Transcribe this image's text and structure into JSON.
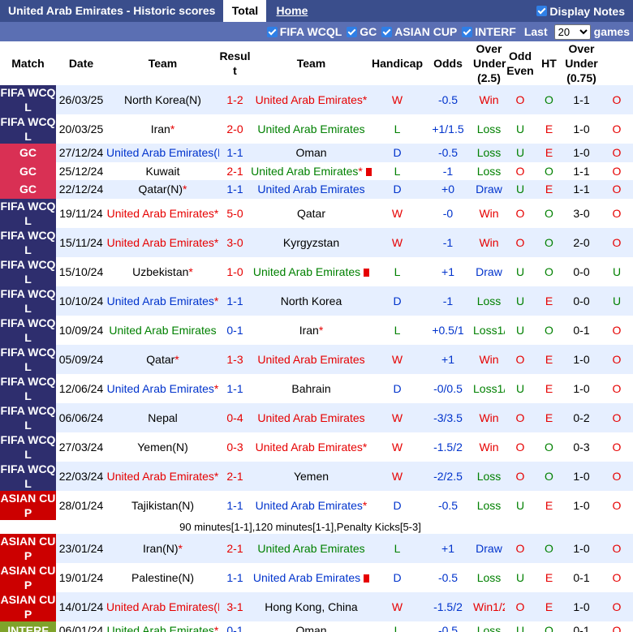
{
  "header": {
    "title": "United Arab Emirates - Historic scores",
    "tab_total": "Total",
    "tab_home": "Home",
    "display_notes": "Display Notes"
  },
  "filters": {
    "items": [
      "FIFA WCQL",
      "GC",
      "ASIAN CUP",
      "INTERF"
    ],
    "last_label": "Last",
    "games_value": "20",
    "games_label": "games"
  },
  "columns": {
    "match": "Match",
    "date": "Date",
    "team": "Team",
    "result": "Resul t",
    "team2": "Team",
    "handicap": "Handicap",
    "odds": "Odds",
    "over_under": "Over Under (2.5)",
    "odd_even": "Odd Even",
    "ht": "HT",
    "over_under2": "Over Under (0.75)"
  },
  "colors": {
    "header_bar": "#3a4e8c",
    "filter_bar": "#5b6fb3",
    "fifa": "#2e2e6e",
    "gc": "#d93054",
    "asian": "#cc0000",
    "interf": "#7fa32a",
    "row_alt": "#e6efff"
  },
  "rows": [
    {
      "type": "match",
      "comp": "FIFA WCQ L",
      "compClass": "fifa",
      "date": "26/03/25",
      "home": "North Korea(N)",
      "homeColor": "",
      "homeStar": false,
      "homeCard": false,
      "score": "1-2",
      "scoreColor": "red",
      "away": "United Arab Emirates",
      "awayColor": "red",
      "awayStar": true,
      "awayCard": false,
      "res": "W",
      "resColor": "red",
      "hcp": "-0.5",
      "odds": "Win",
      "oddsColor": "red",
      "ou": "O",
      "ouColor": "red",
      "oe": "O",
      "oeColor": "green",
      "ht": "1-1",
      "ou2": "O",
      "ou2Color": "red"
    },
    {
      "type": "match",
      "comp": "FIFA WCQ L",
      "compClass": "fifa",
      "date": "20/03/25",
      "home": "Iran",
      "homeColor": "",
      "homeStar": true,
      "homeCard": false,
      "score": "2-0",
      "scoreColor": "red",
      "away": "United Arab Emirates",
      "awayColor": "green",
      "awayStar": false,
      "awayCard": false,
      "res": "L",
      "resColor": "green",
      "hcp": "+1/1.5",
      "odds": "Loss",
      "oddsColor": "green",
      "ou": "U",
      "ouColor": "green",
      "oe": "E",
      "oeColor": "red",
      "ht": "1-0",
      "ou2": "O",
      "ou2Color": "red"
    },
    {
      "type": "match",
      "comp": "GC",
      "compClass": "gc",
      "date": "27/12/24",
      "home": "United Arab Emirates(N)",
      "homeColor": "blue",
      "homeStar": true,
      "homeCard": false,
      "score": "1-1",
      "scoreColor": "blue",
      "away": "Oman",
      "awayColor": "",
      "awayStar": false,
      "awayCard": false,
      "res": "D",
      "resColor": "blue",
      "hcp": "-0.5",
      "odds": "Loss",
      "oddsColor": "green",
      "ou": "U",
      "ouColor": "green",
      "oe": "E",
      "oeColor": "red",
      "ht": "1-0",
      "ou2": "O",
      "ou2Color": "red"
    },
    {
      "type": "match",
      "comp": "GC",
      "compClass": "gc",
      "date": "25/12/24",
      "home": "Kuwait",
      "homeColor": "",
      "homeStar": false,
      "homeCard": false,
      "score": "2-1",
      "scoreColor": "red",
      "away": "United Arab Emirates",
      "awayColor": "green",
      "awayStar": true,
      "awayCard": true,
      "res": "L",
      "resColor": "green",
      "hcp": "-1",
      "odds": "Loss",
      "oddsColor": "green",
      "ou": "O",
      "ouColor": "red",
      "oe": "O",
      "oeColor": "green",
      "ht": "1-1",
      "ou2": "O",
      "ou2Color": "red"
    },
    {
      "type": "match",
      "comp": "GC",
      "compClass": "gc",
      "date": "22/12/24",
      "home": "Qatar(N)",
      "homeColor": "",
      "homeStar": true,
      "homeCard": false,
      "score": "1-1",
      "scoreColor": "blue",
      "away": "United Arab Emirates",
      "awayColor": "blue",
      "awayStar": false,
      "awayCard": false,
      "res": "D",
      "resColor": "blue",
      "hcp": "+0",
      "odds": "Draw",
      "oddsColor": "blue",
      "ou": "U",
      "ouColor": "green",
      "oe": "E",
      "oeColor": "red",
      "ht": "1-1",
      "ou2": "O",
      "ou2Color": "red"
    },
    {
      "type": "match",
      "comp": "FIFA WCQ L",
      "compClass": "fifa",
      "date": "19/11/24",
      "home": "United Arab Emirates",
      "homeColor": "red",
      "homeStar": true,
      "homeCard": false,
      "score": "5-0",
      "scoreColor": "red",
      "away": "Qatar",
      "awayColor": "",
      "awayStar": false,
      "awayCard": false,
      "res": "W",
      "resColor": "red",
      "hcp": "-0",
      "odds": "Win",
      "oddsColor": "red",
      "ou": "O",
      "ouColor": "red",
      "oe": "O",
      "oeColor": "green",
      "ht": "3-0",
      "ou2": "O",
      "ou2Color": "red"
    },
    {
      "type": "match",
      "comp": "FIFA WCQ L",
      "compClass": "fifa",
      "date": "15/11/24",
      "home": "United Arab Emirates",
      "homeColor": "red",
      "homeStar": true,
      "homeCard": false,
      "score": "3-0",
      "scoreColor": "red",
      "away": "Kyrgyzstan",
      "awayColor": "",
      "awayStar": false,
      "awayCard": false,
      "res": "W",
      "resColor": "red",
      "hcp": "-1",
      "odds": "Win",
      "oddsColor": "red",
      "ou": "O",
      "ouColor": "red",
      "oe": "O",
      "oeColor": "green",
      "ht": "2-0",
      "ou2": "O",
      "ou2Color": "red"
    },
    {
      "type": "match",
      "comp": "FIFA WCQ L",
      "compClass": "fifa",
      "date": "15/10/24",
      "home": "Uzbekistan",
      "homeColor": "",
      "homeStar": true,
      "homeCard": false,
      "score": "1-0",
      "scoreColor": "red",
      "away": "United Arab Emirates",
      "awayColor": "green",
      "awayStar": false,
      "awayCard": true,
      "res": "L",
      "resColor": "green",
      "hcp": "+1",
      "odds": "Draw",
      "oddsColor": "blue",
      "ou": "U",
      "ouColor": "green",
      "oe": "O",
      "oeColor": "green",
      "ht": "0-0",
      "ou2": "U",
      "ou2Color": "green"
    },
    {
      "type": "match",
      "comp": "FIFA WCQ L",
      "compClass": "fifa",
      "date": "10/10/24",
      "home": "United Arab Emirates",
      "homeColor": "blue",
      "homeStar": true,
      "homeCard": false,
      "score": "1-1",
      "scoreColor": "blue",
      "away": "North Korea",
      "awayColor": "",
      "awayStar": false,
      "awayCard": false,
      "res": "D",
      "resColor": "blue",
      "hcp": "-1",
      "odds": "Loss",
      "oddsColor": "green",
      "ou": "U",
      "ouColor": "green",
      "oe": "E",
      "oeColor": "red",
      "ht": "0-0",
      "ou2": "U",
      "ou2Color": "green"
    },
    {
      "type": "match",
      "comp": "FIFA WCQ L",
      "compClass": "fifa",
      "date": "10/09/24",
      "home": "United Arab Emirates",
      "homeColor": "green",
      "homeStar": false,
      "homeCard": false,
      "score": "0-1",
      "scoreColor": "blue",
      "away": "Iran",
      "awayColor": "",
      "awayStar": true,
      "awayCard": false,
      "res": "L",
      "resColor": "green",
      "hcp": "+0.5/1",
      "odds": "Loss1/2",
      "oddsColor": "green",
      "ou": "U",
      "ouColor": "green",
      "oe": "O",
      "oeColor": "green",
      "ht": "0-1",
      "ou2": "O",
      "ou2Color": "red"
    },
    {
      "type": "match",
      "comp": "FIFA WCQ L",
      "compClass": "fifa",
      "date": "05/09/24",
      "home": "Qatar",
      "homeColor": "",
      "homeStar": true,
      "homeCard": false,
      "score": "1-3",
      "scoreColor": "red",
      "away": "United Arab Emirates",
      "awayColor": "red",
      "awayStar": false,
      "awayCard": false,
      "res": "W",
      "resColor": "red",
      "hcp": "+1",
      "odds": "Win",
      "oddsColor": "red",
      "ou": "O",
      "ouColor": "red",
      "oe": "E",
      "oeColor": "red",
      "ht": "1-0",
      "ou2": "O",
      "ou2Color": "red"
    },
    {
      "type": "match",
      "comp": "FIFA WCQ L",
      "compClass": "fifa",
      "date": "12/06/24",
      "home": "United Arab Emirates",
      "homeColor": "blue",
      "homeStar": true,
      "homeCard": false,
      "score": "1-1",
      "scoreColor": "blue",
      "away": "Bahrain",
      "awayColor": "",
      "awayStar": false,
      "awayCard": false,
      "res": "D",
      "resColor": "blue",
      "hcp": "-0/0.5",
      "odds": "Loss1/2",
      "oddsColor": "green",
      "ou": "U",
      "ouColor": "green",
      "oe": "E",
      "oeColor": "red",
      "ht": "1-0",
      "ou2": "O",
      "ou2Color": "red"
    },
    {
      "type": "match",
      "comp": "FIFA WCQ L",
      "compClass": "fifa",
      "date": "06/06/24",
      "home": "Nepal",
      "homeColor": "",
      "homeStar": false,
      "homeCard": false,
      "score": "0-4",
      "scoreColor": "red",
      "away": "United Arab Emirates",
      "awayColor": "red",
      "awayStar": false,
      "awayCard": false,
      "res": "W",
      "resColor": "red",
      "hcp": "-3/3.5",
      "odds": "Win",
      "oddsColor": "red",
      "ou": "O",
      "ouColor": "red",
      "oe": "E",
      "oeColor": "red",
      "ht": "0-2",
      "ou2": "O",
      "ou2Color": "red"
    },
    {
      "type": "match",
      "comp": "FIFA WCQ L",
      "compClass": "fifa",
      "date": "27/03/24",
      "home": "Yemen(N)",
      "homeColor": "",
      "homeStar": false,
      "homeCard": false,
      "score": "0-3",
      "scoreColor": "red",
      "away": "United Arab Emirates",
      "awayColor": "red",
      "awayStar": true,
      "awayCard": false,
      "res": "W",
      "resColor": "red",
      "hcp": "-1.5/2",
      "odds": "Win",
      "oddsColor": "red",
      "ou": "O",
      "ouColor": "red",
      "oe": "O",
      "oeColor": "green",
      "ht": "0-3",
      "ou2": "O",
      "ou2Color": "red"
    },
    {
      "type": "match",
      "comp": "FIFA WCQ L",
      "compClass": "fifa",
      "date": "22/03/24",
      "home": "United Arab Emirates",
      "homeColor": "red",
      "homeStar": true,
      "homeCard": false,
      "score": "2-1",
      "scoreColor": "red",
      "away": "Yemen",
      "awayColor": "",
      "awayStar": false,
      "awayCard": false,
      "res": "W",
      "resColor": "red",
      "hcp": "-2/2.5",
      "odds": "Loss",
      "oddsColor": "green",
      "ou": "O",
      "ouColor": "red",
      "oe": "O",
      "oeColor": "green",
      "ht": "1-0",
      "ou2": "O",
      "ou2Color": "red"
    },
    {
      "type": "match",
      "comp": "ASIAN CU P",
      "compClass": "asian",
      "date": "28/01/24",
      "home": "Tajikistan(N)",
      "homeColor": "",
      "homeStar": false,
      "homeCard": false,
      "score": "1-1",
      "scoreColor": "blue",
      "away": "United Arab Emirates",
      "awayColor": "blue",
      "awayStar": true,
      "awayCard": false,
      "res": "D",
      "resColor": "blue",
      "hcp": "-0.5",
      "odds": "Loss",
      "oddsColor": "green",
      "ou": "U",
      "ouColor": "green",
      "oe": "E",
      "oeColor": "red",
      "ht": "1-0",
      "ou2": "O",
      "ou2Color": "red"
    },
    {
      "type": "note",
      "text": "90 minutes[1-1],120 minutes[1-1],Penalty Kicks[5-3]"
    },
    {
      "type": "match",
      "comp": "ASIAN CU P",
      "compClass": "asian",
      "date": "23/01/24",
      "home": "Iran(N)",
      "homeColor": "",
      "homeStar": true,
      "homeCard": false,
      "score": "2-1",
      "scoreColor": "red",
      "away": "United Arab Emirates",
      "awayColor": "green",
      "awayStar": false,
      "awayCard": false,
      "res": "L",
      "resColor": "green",
      "hcp": "+1",
      "odds": "Draw",
      "oddsColor": "blue",
      "ou": "O",
      "ouColor": "red",
      "oe": "O",
      "oeColor": "green",
      "ht": "1-0",
      "ou2": "O",
      "ou2Color": "red"
    },
    {
      "type": "match",
      "comp": "ASIAN CU P",
      "compClass": "asian",
      "date": "19/01/24",
      "home": "Palestine(N)",
      "homeColor": "",
      "homeStar": false,
      "homeCard": false,
      "score": "1-1",
      "scoreColor": "blue",
      "away": "United Arab Emirates",
      "awayColor": "blue",
      "awayStar": false,
      "awayCard": true,
      "res": "D",
      "resColor": "blue",
      "hcp": "-0.5",
      "odds": "Loss",
      "oddsColor": "green",
      "ou": "U",
      "ouColor": "green",
      "oe": "E",
      "oeColor": "red",
      "ht": "0-1",
      "ou2": "O",
      "ou2Color": "red"
    },
    {
      "type": "match",
      "comp": "ASIAN CU P",
      "compClass": "asian",
      "date": "14/01/24",
      "home": "United Arab Emirates(N)",
      "homeColor": "red",
      "homeStar": true,
      "homeCard": false,
      "score": "3-1",
      "scoreColor": "red",
      "away": "Hong Kong, China",
      "awayColor": "",
      "awayStar": false,
      "awayCard": false,
      "res": "W",
      "resColor": "red",
      "hcp": "-1.5/2",
      "odds": "Win1/2",
      "oddsColor": "red",
      "ou": "O",
      "ouColor": "red",
      "oe": "E",
      "oeColor": "red",
      "ht": "1-0",
      "ou2": "O",
      "ou2Color": "red"
    },
    {
      "type": "match",
      "comp": "INTERF",
      "compClass": "interf",
      "date": "06/01/24",
      "home": "United Arab Emirates",
      "homeColor": "green",
      "homeStar": true,
      "homeCard": false,
      "score": "0-1",
      "scoreColor": "blue",
      "away": "Oman",
      "awayColor": "",
      "awayStar": false,
      "awayCard": false,
      "res": "L",
      "resColor": "green",
      "hcp": "-0.5",
      "odds": "Loss",
      "oddsColor": "green",
      "ou": "U",
      "ouColor": "green",
      "oe": "O",
      "oeColor": "green",
      "ht": "0-1",
      "ou2": "O",
      "ou2Color": "red"
    }
  ]
}
